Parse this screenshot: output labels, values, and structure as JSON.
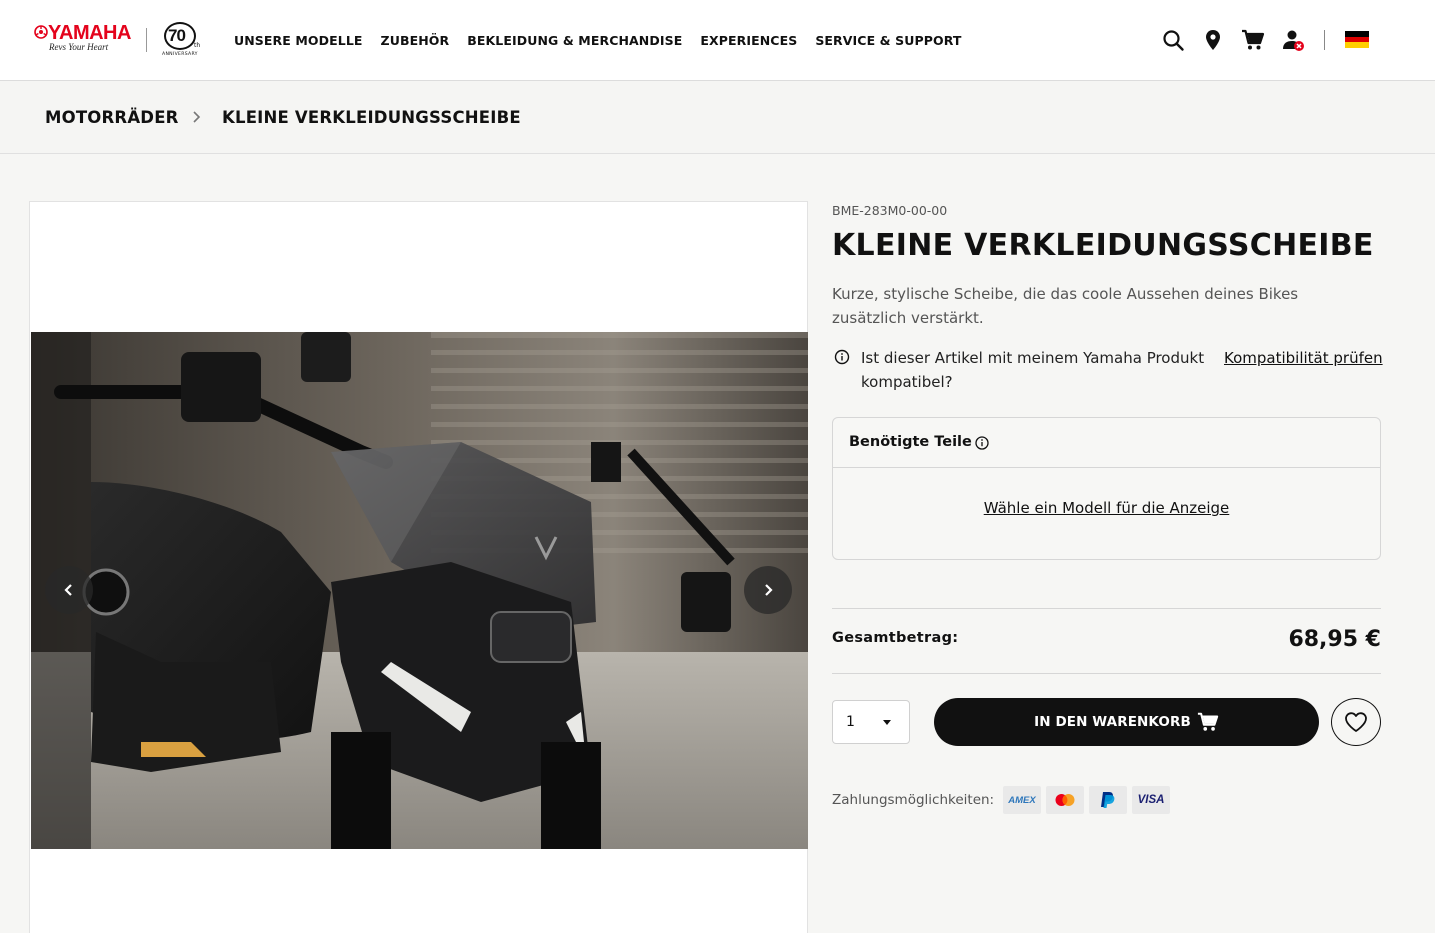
{
  "brand": {
    "logo": "YAMAHA",
    "slogan": "Revs Your Heart",
    "anniversary_number": "70",
    "anniversary_suffix": "th",
    "anniversary_label": "ANNIVERSARY",
    "brand_color": "#e4031c"
  },
  "nav": {
    "items": [
      {
        "label": "UNSERE MODELLE"
      },
      {
        "label": "ZUBEHÖR"
      },
      {
        "label": "BEKLEIDUNG & MERCHANDISE"
      },
      {
        "label": "EXPERIENCES"
      },
      {
        "label": "SERVICE & SUPPORT"
      }
    ]
  },
  "header_icons": [
    "search-icon",
    "location-pin-icon",
    "cart-icon",
    "account-icon",
    "germany-flag-icon"
  ],
  "breadcrumb": {
    "items": [
      {
        "label": "MOTORRÄDER"
      },
      {
        "label": "KLEINE VERKLEIDUNGSSCHEIBE"
      }
    ]
  },
  "product": {
    "sku": "BME-283M0-00-00",
    "title": "KLEINE VERKLEIDUNGSSCHEIBE",
    "description": "Kurze, stylische Scheibe, die das coole Aussehen deines Bikes zusätzlich verstärkt.",
    "compat_question": "Ist dieser Artikel mit meinem Yamaha Produkt kompatibel?",
    "compat_link": "Kompatibilität prüfen",
    "image_alt": "Motorcycle with small black windscreen"
  },
  "parts": {
    "title": "Benötigte Teile",
    "select_model_link": "Wähle ein Modell für die Anzeige"
  },
  "pricing": {
    "total_label": "Gesamtbetrag:",
    "total_price": "68,95 €"
  },
  "cart": {
    "quantity": "1",
    "add_to_cart_label": "IN DEN WARENKORB"
  },
  "payment": {
    "label": "Zahlungsmöglichkeiten:",
    "methods": [
      {
        "name": "AMEX",
        "color": "#2e77bb"
      },
      {
        "name": "Mastercard",
        "color": "#eb001b"
      },
      {
        "name": "PayPal",
        "color": "#003087"
      },
      {
        "name": "VISA",
        "color": "#1a1f71"
      }
    ]
  }
}
